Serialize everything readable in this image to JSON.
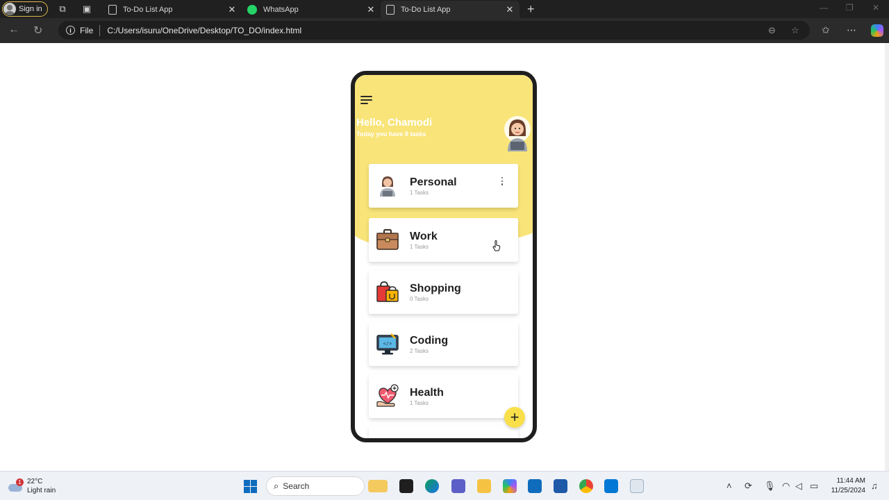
{
  "browser": {
    "sign_in_label": "Sign in",
    "tabs": [
      {
        "title": "To-Do List App"
      },
      {
        "title": "WhatsApp"
      },
      {
        "title": "To-Do List App"
      }
    ],
    "address": {
      "scheme_label": "File",
      "url": "C:/Users/isuru/OneDrive/Desktop/TO_DO/index.html"
    }
  },
  "app": {
    "greeting": "Hello, Chamodi",
    "subtitle": "Today you have 8 tasks",
    "categories": [
      {
        "name": "Personal",
        "count": "1 Tasks",
        "icon": "person-icon"
      },
      {
        "name": "Work",
        "count": "1 Tasks",
        "icon": "briefcase-icon"
      },
      {
        "name": "Shopping",
        "count": "0 Tasks",
        "icon": "shopping-bags-icon"
      },
      {
        "name": "Coding",
        "count": "2 Tasks",
        "icon": "computer-code-icon"
      },
      {
        "name": "Health",
        "count": "1 Tasks",
        "icon": "heart-hand-icon"
      }
    ],
    "fab_label": "+",
    "colors": {
      "header": "#f9e479",
      "fab": "#f9e04a"
    }
  },
  "taskbar": {
    "weather_temp": "22°C",
    "weather_desc": "Light rain",
    "weather_badge": "1",
    "search_label": "Search",
    "time": "11:44 AM",
    "date": "11/25/2024"
  }
}
